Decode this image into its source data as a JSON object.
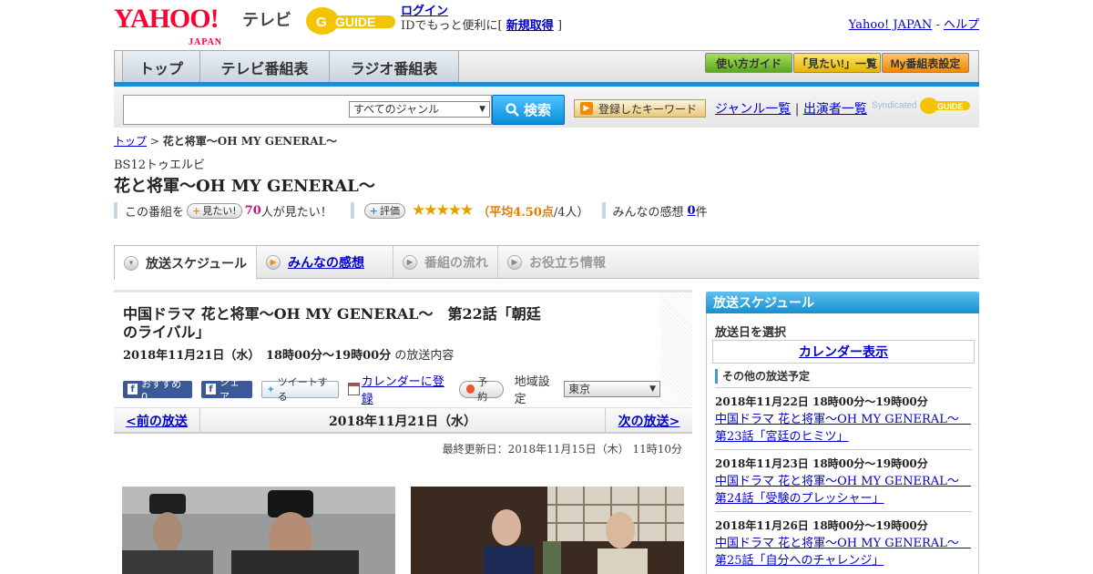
{
  "header": {
    "logo_yahoo": "YAHOO!",
    "logo_japan": "JAPAN",
    "logo_tv": "テレビ",
    "logo_gguide": "G GUIDE",
    "login_link": "ログイン",
    "login_text_prefix": "IDでもっと便利に[",
    "signup_link": "新規取得",
    "login_text_suffix": "]",
    "yahoo_japan_link": "Yahoo! JAPAN",
    "dash": "-",
    "help_link": "ヘルプ"
  },
  "nav": {
    "tabs": [
      "トップ",
      "テレビ番組表",
      "ラジオ番組表"
    ],
    "buttons": [
      "使い方ガイド",
      "「見たい!」一覧",
      "My番組表設定"
    ]
  },
  "search": {
    "genre_selected": "すべてのジャンル",
    "button_label": "検索",
    "keyword_button": "登録したキーワード",
    "genre_list_link": "ジャンル一覧",
    "pipe": "|",
    "performer_list_link": "出演者一覧",
    "syndicated": "Syndicated"
  },
  "breadcrumb": {
    "top_link": "トップ",
    "separator": ">",
    "current": "花と将軍～OH MY GENERAL～"
  },
  "program": {
    "channel": "BS12トゥエルビ",
    "title": "花と将軍～OH MY GENERAL～",
    "want_prefix": "この番組を",
    "want_button": "見たい!",
    "want_count": "70",
    "want_suffix": "人が見たい！",
    "rating_button": "評価",
    "stars": "★★★★★",
    "avg_prefix": "（",
    "avg_label": "平均4.50点",
    "avg_suffix": "/4人）",
    "impressions_prefix": "みんなの感想",
    "impressions_count": "0",
    "impressions_suffix": "件"
  },
  "subtabs": [
    "放送スケジュール",
    "みんなの感想",
    "番組の流れ",
    "お役立ち情報"
  ],
  "episode": {
    "title": "中国ドラマ 花と将軍～OH MY GENERAL～　第22話「朝廷のライバル」",
    "datetime": "2018年11月21日（水）　18時00分～19時00分",
    "datetime_suffix": "の放送内容",
    "fb_recommend": "おすすめ 0",
    "fb_share": "シェア",
    "tweet": "ツイートする",
    "calendar_link": "カレンダーに登録",
    "reserve": "予約",
    "region_label": "地域設定",
    "region_value": "東京"
  },
  "pager": {
    "prev": "<前の放送",
    "current": "2018年11月21日（水）",
    "next": "次の放送>"
  },
  "updated": "最終更新日：2018年11月15日（木）  11時10分",
  "sidebar": {
    "heading": "放送スケジュール",
    "select_date": "放送日を選択",
    "calendar_button": "カレンダー表示",
    "other_heading": "その他の放送予定",
    "items": [
      {
        "date": "2018年11月22日  18時00分～19時00分",
        "title": "中国ドラマ 花と将軍～OH MY GENERAL～　第23話「宮廷のヒミツ」"
      },
      {
        "date": "2018年11月23日  18時00分～19時00分",
        "title": "中国ドラマ 花と将軍～OH MY GENERAL～　第24話「受験のプレッシャー」"
      },
      {
        "date": "2018年11月26日  18時00分～19時00分",
        "title": "中国ドラマ 花と将軍～OH MY GENERAL～　第25話「自分へのチャレンジ」"
      }
    ]
  },
  "colors": {
    "accent_blue": "#1b8fd6",
    "yahoo_red": "#ff0033",
    "rating_orange": "#e37b00",
    "link": "#0000cc"
  }
}
